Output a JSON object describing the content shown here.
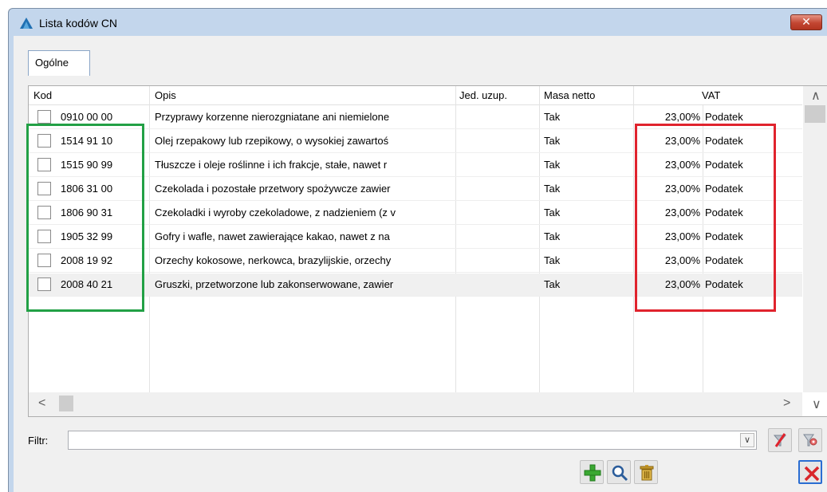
{
  "window": {
    "title": "Lista kodów CN",
    "close_glyph": "✕"
  },
  "tabs": [
    {
      "label": "Ogólne"
    }
  ],
  "grid": {
    "columns": [
      {
        "label": "Kod"
      },
      {
        "label": "Opis"
      },
      {
        "label": "Jed. uzup."
      },
      {
        "label": "Masa netto"
      },
      {
        "label": "VAT"
      }
    ],
    "rows": [
      {
        "code": "0910 00 00",
        "description": "Przyprawy korzenne nierozgniatane ani niemielone",
        "jed_uzup": "",
        "masa_netto": "Tak",
        "vat_rate": "23,00%",
        "vat_type": "Podatek"
      },
      {
        "code": "1514 91 10",
        "description": "Olej rzepakowy lub rzepikowy, o wysokiej zawartoś",
        "jed_uzup": "",
        "masa_netto": "Tak",
        "vat_rate": "23,00%",
        "vat_type": "Podatek"
      },
      {
        "code": "1515 90 99",
        "description": "Tłuszcze i oleje roślinne i ich frakcje, stałe, nawet r",
        "jed_uzup": "",
        "masa_netto": "Tak",
        "vat_rate": "23,00%",
        "vat_type": "Podatek"
      },
      {
        "code": "1806 31 00",
        "description": "Czekolada i pozostałe przetwory spożywcze zawier",
        "jed_uzup": "",
        "masa_netto": "Tak",
        "vat_rate": "23,00%",
        "vat_type": "Podatek"
      },
      {
        "code": "1806 90 31",
        "description": "Czekoladki i wyroby czekoladowe, z nadzieniem (z v",
        "jed_uzup": "",
        "masa_netto": "Tak",
        "vat_rate": "23,00%",
        "vat_type": "Podatek"
      },
      {
        "code": "1905 32 99",
        "description": "Gofry i wafle, nawet zawierające kakao, nawet z na",
        "jed_uzup": "",
        "masa_netto": "Tak",
        "vat_rate": "23,00%",
        "vat_type": "Podatek"
      },
      {
        "code": "2008 19 92",
        "description": "Orzechy kokosowe, nerkowca, brazylijskie, orzechy",
        "jed_uzup": "",
        "masa_netto": "Tak",
        "vat_rate": "23,00%",
        "vat_type": "Podatek"
      },
      {
        "code": "2008 40 21",
        "description": "Gruszki, przetworzone lub zakonserwowane, zawier",
        "jed_uzup": "",
        "masa_netto": "Tak",
        "vat_rate": "23,00%",
        "vat_type": "Podatek"
      }
    ],
    "selected_row_index": 7
  },
  "scroll_glyphs": {
    "up": "∧",
    "down": "∨",
    "left": "<",
    "right": ">"
  },
  "filter": {
    "label": "Filtr:",
    "value": "",
    "dropdown_glyph": "∨"
  },
  "icons": {
    "clear_filter": "clear-filter-icon",
    "filter_settings": "filter-settings-icon",
    "add": "plus-icon",
    "search": "magnifier-icon",
    "delete": "trash-icon",
    "close": "close-icon"
  },
  "colors": {
    "highlight_green": "#22a045",
    "highlight_red": "#e0232d",
    "title_bar": "#c3d6ec",
    "add_green": "#3aa832",
    "delete_gold": "#c79a2b",
    "close_red": "#d9262a",
    "close_focus_blue": "#2a6dd2"
  }
}
